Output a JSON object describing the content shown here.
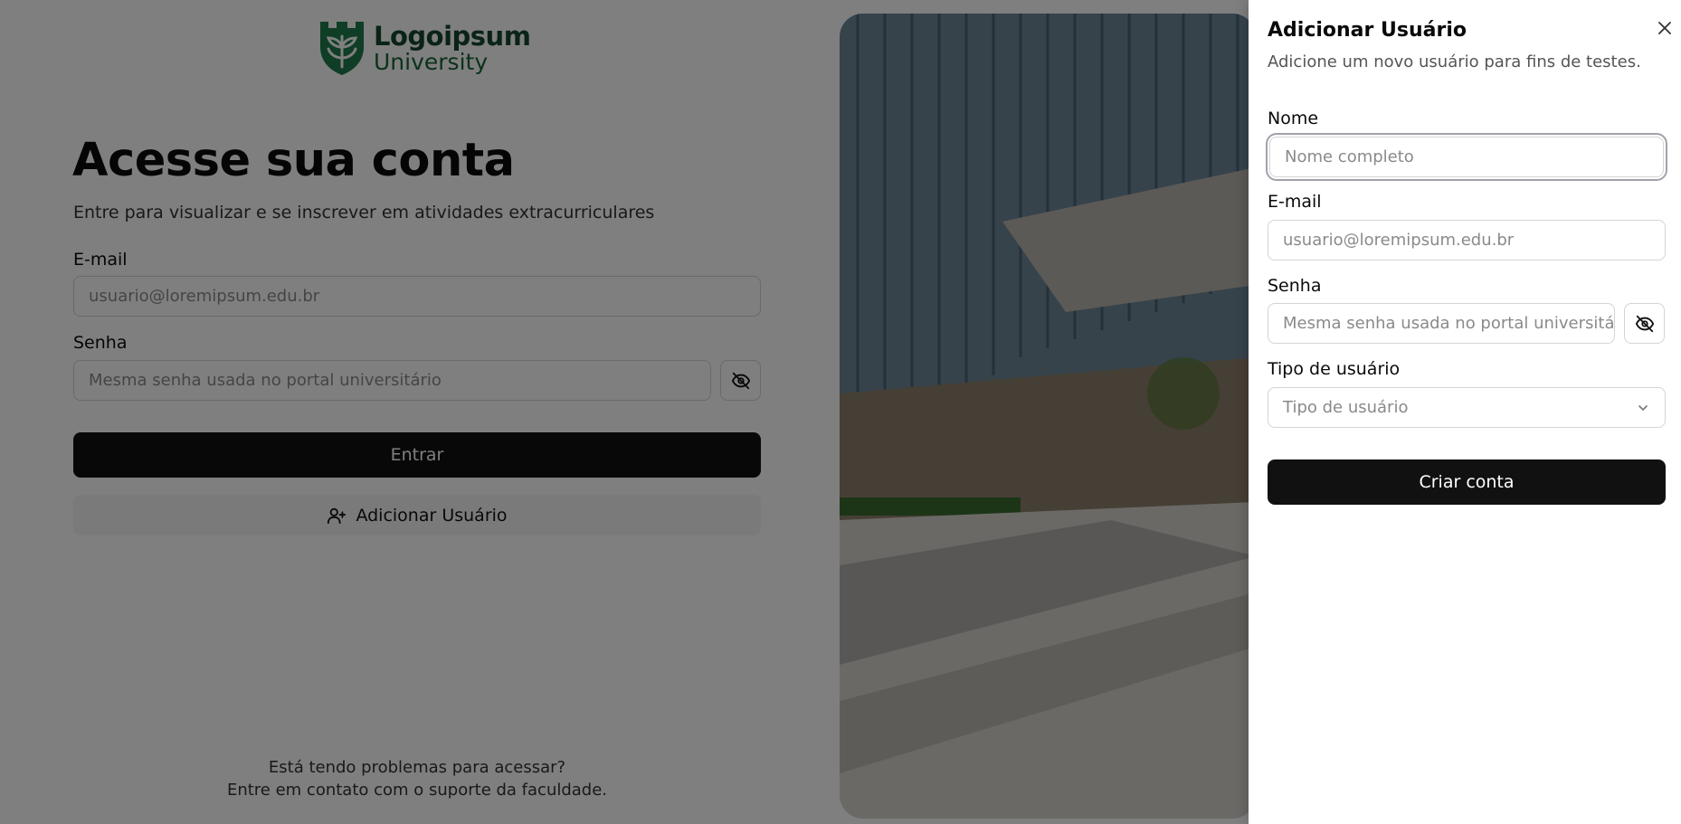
{
  "brand": {
    "name": "Logoipsum",
    "sub": "University",
    "logo_icon": "shield-leaf-logo",
    "color": "#166534"
  },
  "login": {
    "title": "Acesse sua conta",
    "subtitle": "Entre para visualizar e se inscrever em atividades extracurriculares",
    "email_label": "E-mail",
    "email_placeholder": "usuario@loremipsum.edu.br",
    "password_label": "Senha",
    "password_placeholder": "Mesma senha usada no portal universitário",
    "password_toggle_icon": "eye-off-icon",
    "submit_label": "Entrar",
    "add_user_label": "Adicionar Usuário",
    "add_user_icon": "user-plus-icon",
    "help_line1": "Está tendo problemas para acessar?",
    "help_line2": "Entre em contato com o suporte da faculdade."
  },
  "drawer": {
    "title": "Adicionar Usuário",
    "description": "Adicione um novo usuário para fins de testes.",
    "close_icon": "close-icon",
    "name_label": "Nome",
    "name_placeholder": "Nome completo",
    "email_label": "E-mail",
    "email_placeholder": "usuario@loremipsum.edu.br",
    "password_label": "Senha",
    "password_placeholder": "Mesma senha usada no portal universitário",
    "password_toggle_icon": "eye-off-icon",
    "type_label": "Tipo de usuário",
    "type_placeholder": "Tipo de usuário",
    "type_chevron_icon": "chevron-down-icon",
    "submit_label": "Criar conta"
  },
  "colors": {
    "primary_button": "#111111",
    "overlay": "rgba(0,0,0,0.5)"
  }
}
